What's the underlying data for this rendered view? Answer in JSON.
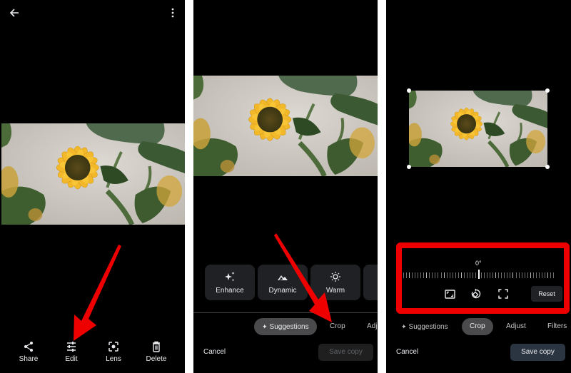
{
  "panels": {
    "viewer": {
      "top_bar": {
        "back_icon": "arrow-left",
        "more_icon": "more-vert"
      },
      "bottom_actions": [
        {
          "label": "Share",
          "icon": "share"
        },
        {
          "label": "Edit",
          "icon": "tune"
        },
        {
          "label": "Lens",
          "icon": "lens"
        },
        {
          "label": "Delete",
          "icon": "trash"
        }
      ]
    },
    "editor_suggestions": {
      "suggestions": [
        {
          "label": "Enhance",
          "icon": "sparkle"
        },
        {
          "label": "Dynamic",
          "icon": "mountain"
        },
        {
          "label": "Warm",
          "icon": "sun"
        }
      ],
      "tabs": [
        {
          "label": "Suggestions",
          "active": true,
          "icon": "sparkle"
        },
        {
          "label": "Crop",
          "active": false
        },
        {
          "label": "Adj",
          "active": false
        }
      ],
      "cancel_label": "Cancel",
      "save_label": "Save copy",
      "save_enabled": false
    },
    "editor_crop": {
      "rotation_angle": "0°",
      "tools": [
        {
          "name": "aspect-ratio",
          "icon": "aspect-ratio"
        },
        {
          "name": "rotate",
          "icon": "rotate"
        },
        {
          "name": "free-crop",
          "icon": "free-crop"
        }
      ],
      "reset_label": "Reset",
      "tabs": [
        {
          "label": "Suggestions",
          "active": false,
          "icon": "sparkle"
        },
        {
          "label": "Crop",
          "active": true
        },
        {
          "label": "Adjust",
          "active": false
        },
        {
          "label": "Filters",
          "active": false
        }
      ],
      "cancel_label": "Cancel",
      "save_label": "Save copy",
      "save_enabled": true
    }
  },
  "photo": {
    "subject": "Sunflower"
  },
  "colors": {
    "annotation_red": "#ee0000",
    "save_enabled_bg": "#2b3441",
    "save_disabled_bg": "#1f1f1f",
    "active_tab_bg": "#4a4a4c"
  }
}
